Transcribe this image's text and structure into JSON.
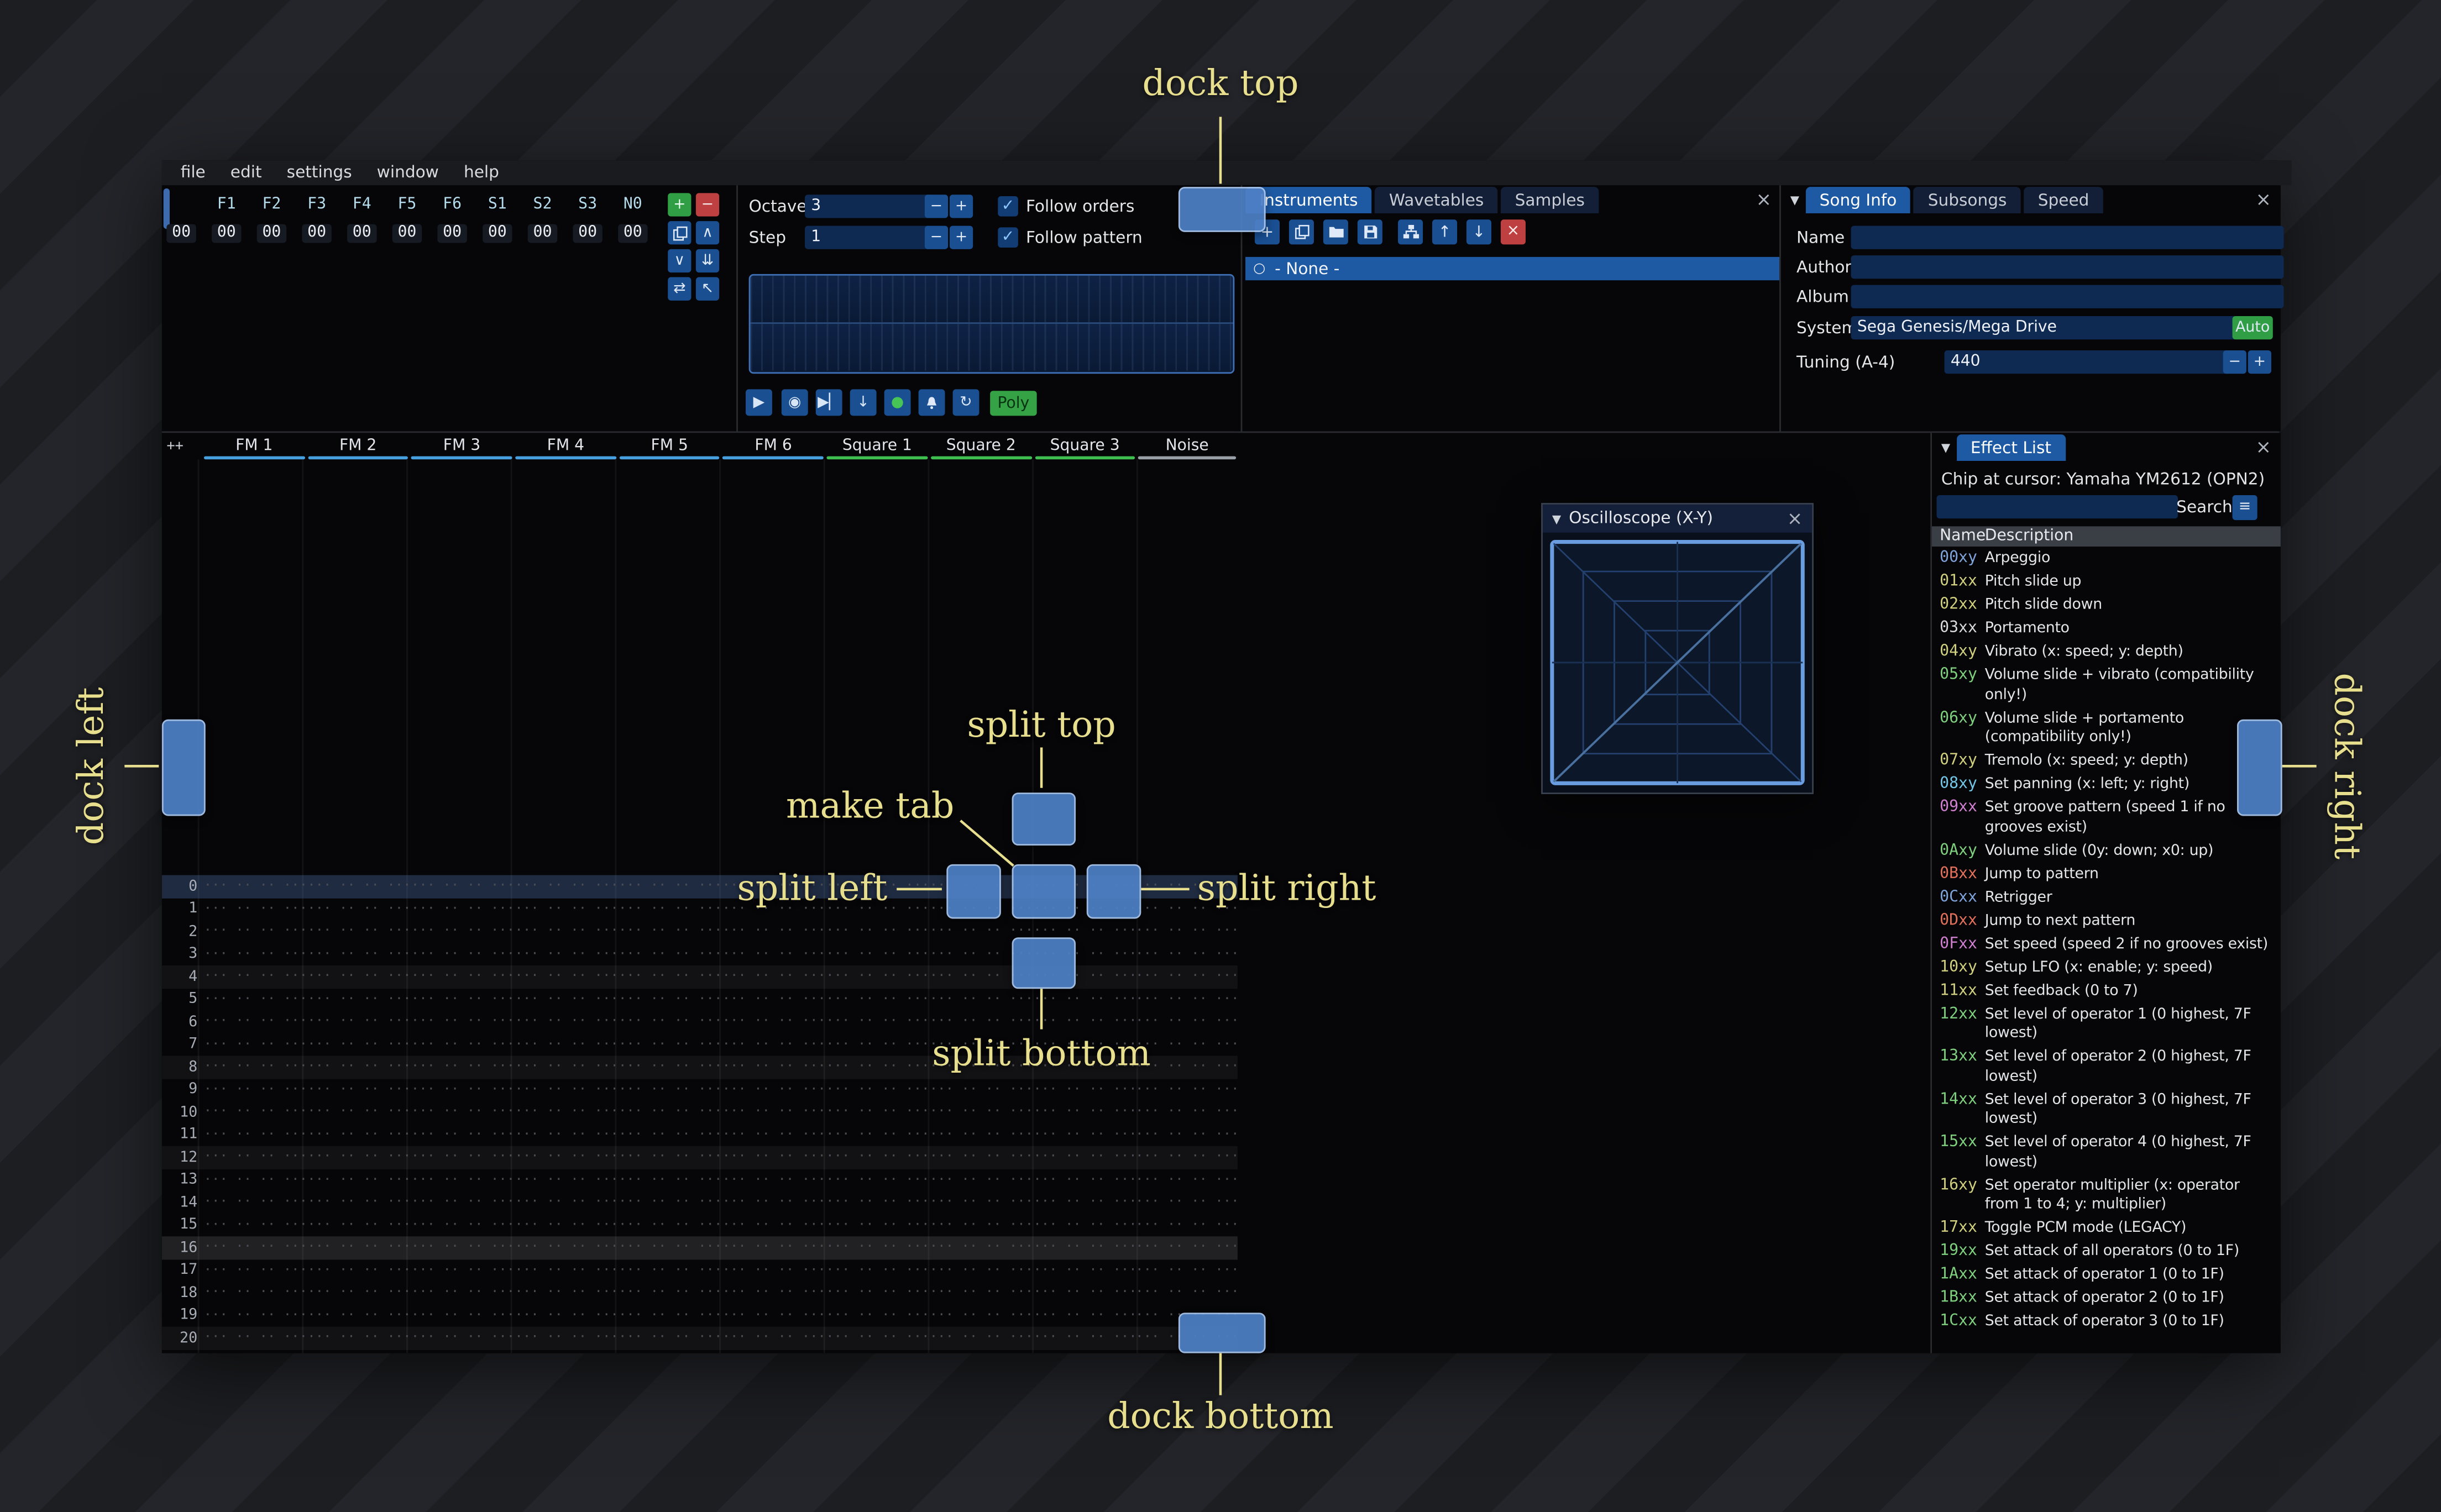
{
  "colors": {
    "overlay_label": "#e8df8e",
    "dock_fill": "#4e80c6",
    "dock_border": "#abc8f0",
    "fm_channel": "#46a0e0",
    "square_channel": "#3fbf4f",
    "noise_channel": "#9aa0a8"
  },
  "icons": {
    "plus": "+",
    "minus": "−",
    "close": "×",
    "check": "✓",
    "collapse": "▼",
    "chev_up": "∧",
    "chev_down": "∨",
    "dbl_down": "⇊",
    "swap": "⇄",
    "cursor": "↖",
    "arrow_up": "↑",
    "arrow_down": "↓",
    "play": "▶",
    "play_cursor": "◉",
    "play_once": "▶▏",
    "step_row": "↓",
    "record": "●",
    "repeat": "↻",
    "burger": "≡",
    "radio": "○"
  },
  "window": {
    "menu": [
      "file",
      "edit",
      "settings",
      "window",
      "help"
    ]
  },
  "orders": {
    "row_label": "00",
    "channels": [
      "F1",
      "F2",
      "F3",
      "F4",
      "F5",
      "F6",
      "S1",
      "S2",
      "S3",
      "N0"
    ],
    "values": [
      "00",
      "00",
      "00",
      "00",
      "00",
      "00",
      "00",
      "00",
      "00",
      "00"
    ]
  },
  "transport": {
    "octave_label": "Octave",
    "octave_value": "3",
    "step_label": "Step",
    "step_value": "1",
    "follow_orders": "Follow orders",
    "follow_pattern": "Follow pattern",
    "poly_label": "Poly"
  },
  "instruments": {
    "tabs": [
      "Instruments",
      "Wavetables",
      "Samples"
    ],
    "active_tab": "Instruments",
    "none_item": "- None -"
  },
  "song_info": {
    "tabs": [
      "Song Info",
      "Subsongs",
      "Speed"
    ],
    "active_tab": "Song Info",
    "name_label": "Name",
    "name_value": "",
    "author_label": "Author",
    "author_value": "",
    "album_label": "Album",
    "album_value": "",
    "system_label": "System",
    "system_value": "Sega Genesis/Mega Drive",
    "auto_label": "Auto",
    "tuning_label": "Tuning (A-4)",
    "tuning_value": "440"
  },
  "pattern": {
    "corner_label": "++",
    "channels": [
      {
        "name": "FM 1",
        "type": "fm"
      },
      {
        "name": "FM 2",
        "type": "fm"
      },
      {
        "name": "FM 3",
        "type": "fm"
      },
      {
        "name": "FM 4",
        "type": "fm"
      },
      {
        "name": "FM 5",
        "type": "fm"
      },
      {
        "name": "FM 6",
        "type": "fm"
      },
      {
        "name": "Square 1",
        "type": "sq"
      },
      {
        "name": "Square 2",
        "type": "sq"
      },
      {
        "name": "Square 3",
        "type": "sq"
      },
      {
        "name": "Noise",
        "type": "noise"
      }
    ],
    "row_count": 22,
    "cursor_row": 0,
    "empty_cell": "··· ·· ·· ···"
  },
  "oscilloscope": {
    "title": "Oscilloscope (X-Y)"
  },
  "effect_list": {
    "tab": "Effect List",
    "chip_line": "Chip at cursor: Yamaha YM2612 (OPN2)",
    "search_label": "Search",
    "name_col": "Name",
    "desc_col": "Description",
    "effects": [
      {
        "code": "00xy",
        "color": "#7ea4db",
        "desc": "Arpeggio"
      },
      {
        "code": "01xx",
        "color": "#d0d07e",
        "desc": "Pitch slide up"
      },
      {
        "code": "02xx",
        "color": "#d0d07e",
        "desc": "Pitch slide down"
      },
      {
        "code": "03xx",
        "color": "#d9dadd",
        "desc": "Portamento"
      },
      {
        "code": "04xy",
        "color": "#d0d07e",
        "desc": "Vibrato (x: speed; y: depth)"
      },
      {
        "code": "05xy",
        "color": "#7ed07e",
        "desc": "Volume slide + vibrato (compatibility only!)"
      },
      {
        "code": "06xy",
        "color": "#7ed07e",
        "desc": "Volume slide + portamento (compatibility only!)"
      },
      {
        "code": "07xy",
        "color": "#d0d07e",
        "desc": "Tremolo (x: speed; y: depth)"
      },
      {
        "code": "08xy",
        "color": "#72c6e8",
        "desc": "Set panning (x: left; y: right)"
      },
      {
        "code": "09xx",
        "color": "#d07ed0",
        "desc": "Set groove pattern (speed 1 if no grooves exist)"
      },
      {
        "code": "0Axy",
        "color": "#7ed07e",
        "desc": "Volume slide (0y: down; x0: up)"
      },
      {
        "code": "0Bxx",
        "color": "#e2705a",
        "desc": "Jump to pattern"
      },
      {
        "code": "0Cxx",
        "color": "#7ea4db",
        "desc": "Retrigger"
      },
      {
        "code": "0Dxx",
        "color": "#e2705a",
        "desc": "Jump to next pattern"
      },
      {
        "code": "0Fxx",
        "color": "#d07ed0",
        "desc": "Set speed (speed 2 if no grooves exist)"
      },
      {
        "code": "10xy",
        "color": "#d0d07e",
        "desc": "Setup LFO (x: enable; y: speed)"
      },
      {
        "code": "11xx",
        "color": "#d0d07e",
        "desc": "Set feedback (0 to 7)"
      },
      {
        "code": "12xx",
        "color": "#7ed07e",
        "desc": "Set level of operator 1 (0 highest, 7F lowest)"
      },
      {
        "code": "13xx",
        "color": "#7ed07e",
        "desc": "Set level of operator 2 (0 highest, 7F lowest)"
      },
      {
        "code": "14xx",
        "color": "#7ed07e",
        "desc": "Set level of operator 3 (0 highest, 7F lowest)"
      },
      {
        "code": "15xx",
        "color": "#7ed07e",
        "desc": "Set level of operator 4 (0 highest, 7F lowest)"
      },
      {
        "code": "16xy",
        "color": "#d0d07e",
        "desc": "Set operator multiplier (x: operator from 1 to 4; y: multiplier)"
      },
      {
        "code": "17xx",
        "color": "#d0d07e",
        "desc": "Toggle PCM mode (LEGACY)"
      },
      {
        "code": "19xx",
        "color": "#7ed07e",
        "desc": "Set attack of all operators (0 to 1F)"
      },
      {
        "code": "1Axx",
        "color": "#7ed07e",
        "desc": "Set attack of operator 1 (0 to 1F)"
      },
      {
        "code": "1Bxx",
        "color": "#7ed07e",
        "desc": "Set attack of operator 2 (0 to 1F)"
      },
      {
        "code": "1Cxx",
        "color": "#7ed07e",
        "desc": "Set attack of operator 3 (0 to 1F)"
      }
    ]
  },
  "dock_overlay": {
    "labels": {
      "dock_top": "dock top",
      "dock_bottom": "dock bottom",
      "dock_left": "dock left",
      "dock_right": "dock right",
      "split_top": "split top",
      "split_bottom": "split bottom",
      "split_left": "split left",
      "split_right": "split right",
      "make_tab": "make tab"
    }
  }
}
